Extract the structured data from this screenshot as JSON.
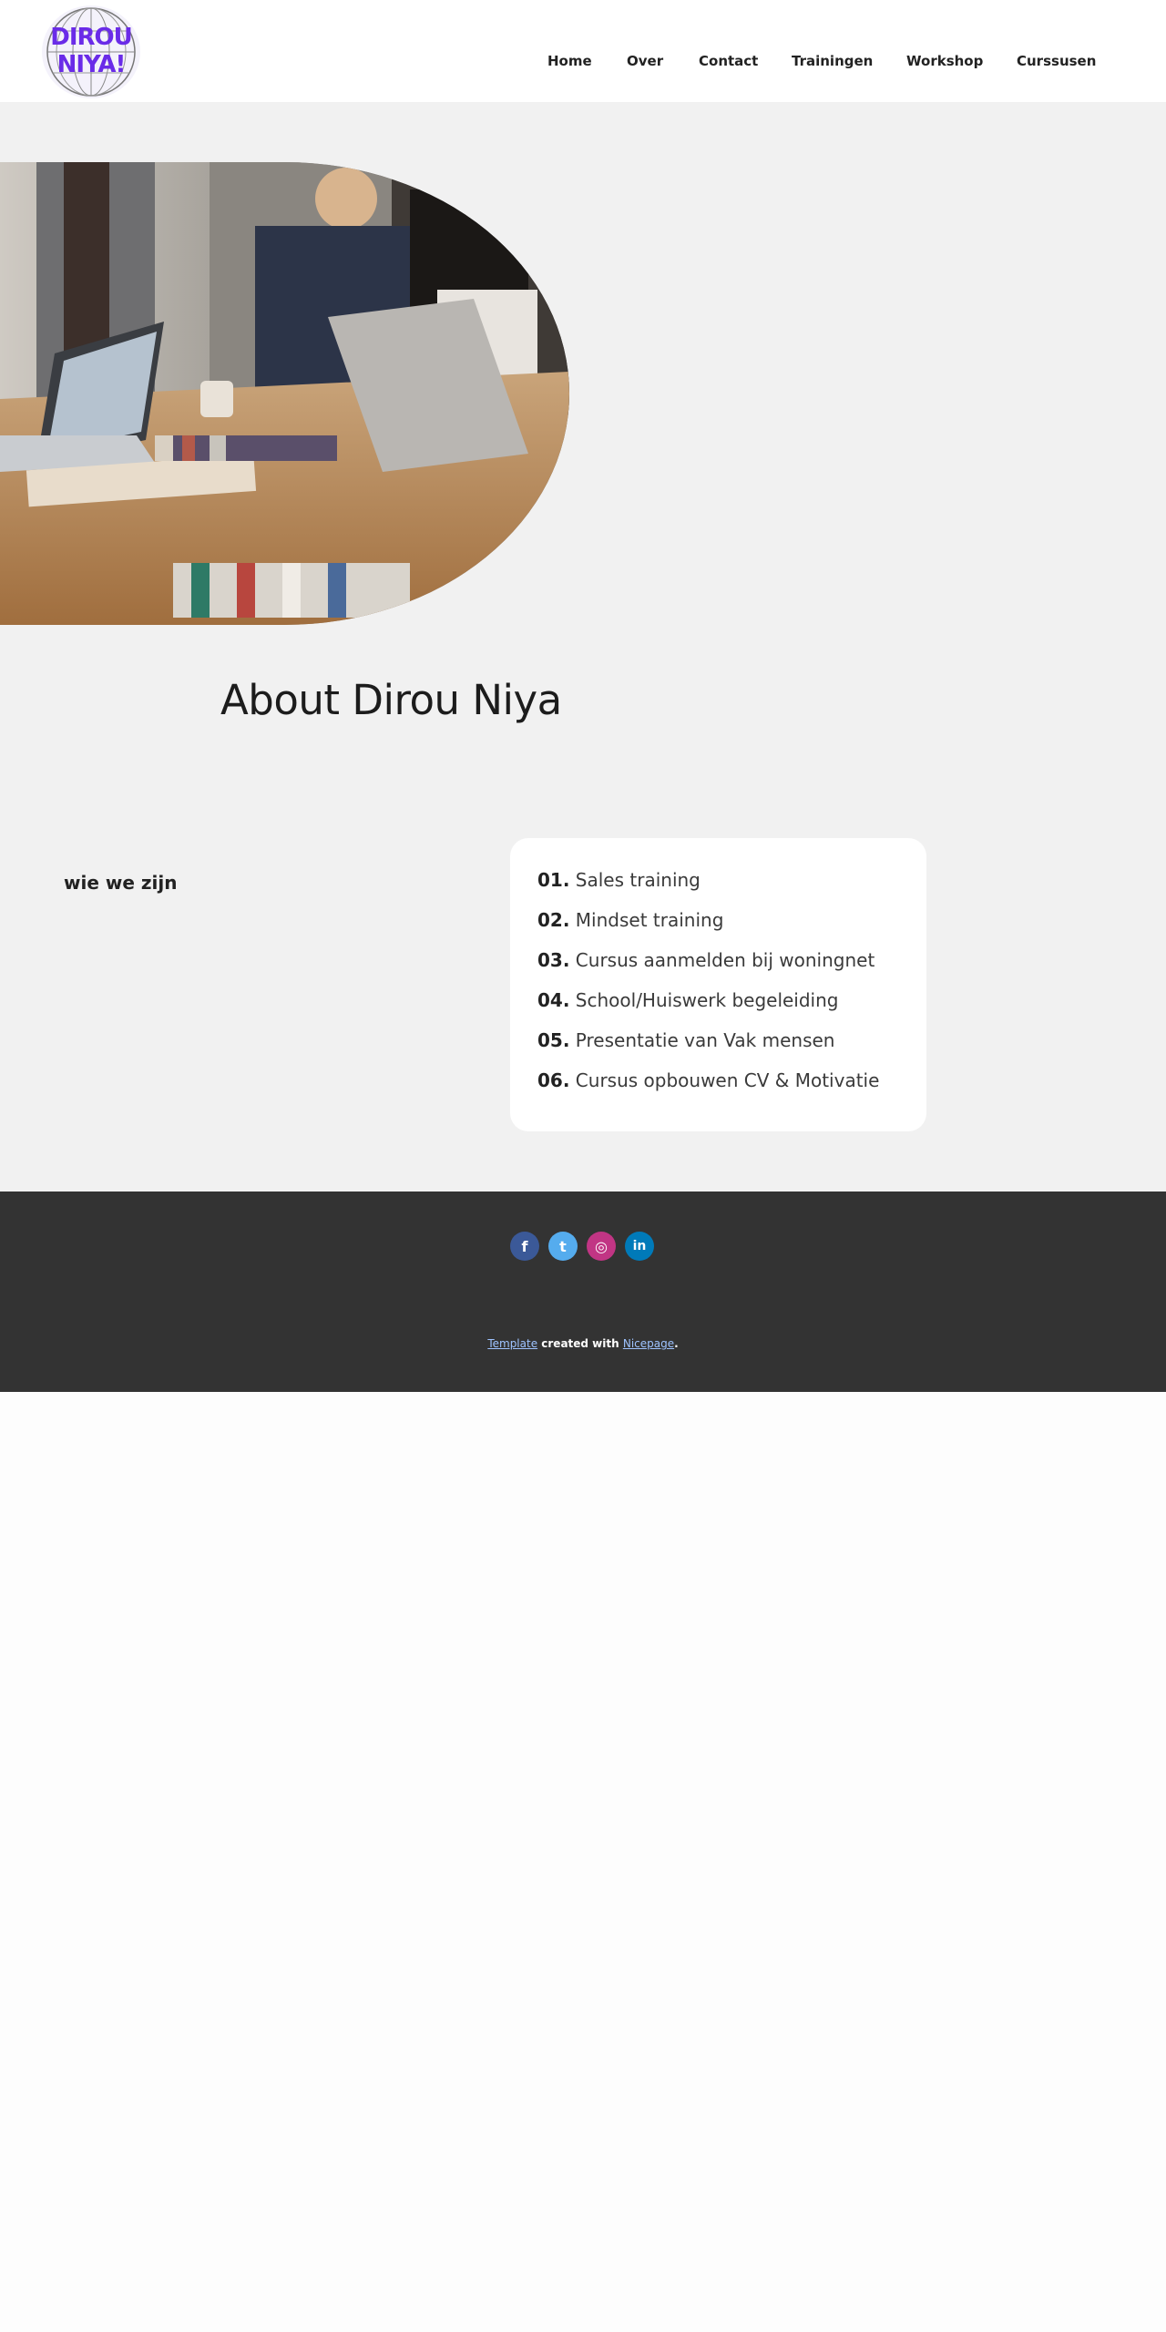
{
  "header": {
    "logo": {
      "line1": "DIROU",
      "line2": "NIYA!",
      "icon": "globe-logo",
      "color": "#6a2be8"
    },
    "nav": [
      {
        "label": "Home"
      },
      {
        "label": "Over"
      },
      {
        "label": "Contact"
      },
      {
        "label": "Trainingen"
      },
      {
        "label": "Workshop"
      },
      {
        "label": "Curssusen"
      }
    ]
  },
  "hero": {
    "image": "meeting-photo"
  },
  "about": {
    "title": "About Dirou Niya"
  },
  "intro": {
    "label": "wie we zijn"
  },
  "services": [
    {
      "num": "01.",
      "label": "Sales training"
    },
    {
      "num": "02.",
      "label": "Mindset training"
    },
    {
      "num": "03.",
      "label": "Cursus aanmelden bij woningnet"
    },
    {
      "num": "04.",
      "label": "School/Huiswerk begeleiding"
    },
    {
      "num": "05.",
      "label": "Presentatie van Vak mensen"
    },
    {
      "num": "06.",
      "label": "Cursus opbouwen CV & Motivatie"
    }
  ],
  "footer": {
    "socials": [
      {
        "name": "facebook-icon",
        "glyph": "f",
        "color": "#3b5998"
      },
      {
        "name": "twitter-icon",
        "glyph": "t",
        "color": "#55acee"
      },
      {
        "name": "instagram-icon",
        "glyph": "◎",
        "color": "#c13584"
      },
      {
        "name": "linkedin-icon",
        "glyph": "in",
        "color": "#007ab9"
      }
    ],
    "credit": {
      "link1": "Template",
      "middle": " created with ",
      "link2": "Nicepage",
      "end": "."
    }
  },
  "colors": {
    "background": "#f1f1f1",
    "footer": "#333333",
    "accent": "#6a2be8"
  }
}
